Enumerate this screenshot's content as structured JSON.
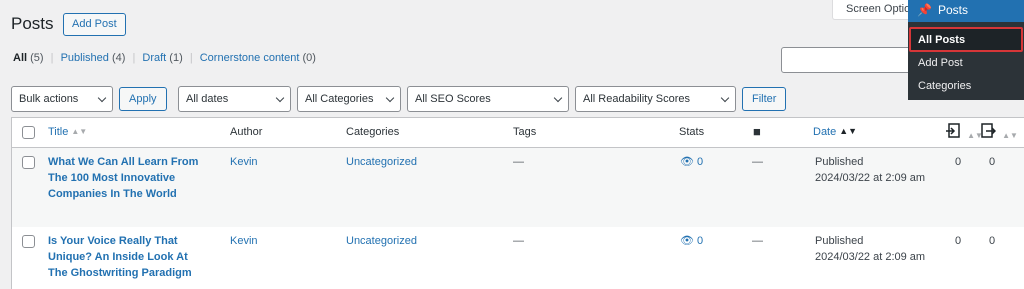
{
  "page": {
    "title": "Posts",
    "add_post_label": "Add Post",
    "screen_options_label": "Screen Options"
  },
  "views": {
    "all_label": "All",
    "all_count": "(5)",
    "published_label": "Published",
    "published_count": "(4)",
    "draft_label": "Draft",
    "draft_count": "(1)",
    "cornerstone_label": "Cornerstone content",
    "cornerstone_count": "(0)"
  },
  "filters": {
    "bulk_actions": "Bulk actions",
    "apply_label": "Apply",
    "dates": "All dates",
    "categories": "All Categories",
    "seo_scores": "All SEO Scores",
    "readability_scores": "All Readability Scores",
    "filter_label": "Filter"
  },
  "columns": {
    "title": "Title",
    "author": "Author",
    "categories": "Categories",
    "tags": "Tags",
    "stats": "Stats",
    "date": "Date"
  },
  "rows": [
    {
      "title_line1": "What We Can All Learn From",
      "title_line2": "The 100 Most Innovative",
      "title_line3": "Companies In The World",
      "author": "Kevin",
      "category": "Uncategorized",
      "tags": "—",
      "stats": "0",
      "comments": "—",
      "date_status": "Published",
      "date_value": "2024/03/22 at 2:09 am",
      "links_in": "0",
      "links_out": "0"
    },
    {
      "title_line1": "Is Your Voice Really That",
      "title_line2": "Unique? An Inside Look At",
      "title_line3": "The Ghostwriting Paradigm",
      "author": "Kevin",
      "category": "Uncategorized",
      "tags": "—",
      "stats": "0",
      "comments": "—",
      "date_status": "Published",
      "date_value": "2024/03/22 at 2:09 am",
      "links_in": "0",
      "links_out": "0"
    }
  ],
  "admin_menu": {
    "heading": "Posts",
    "items": [
      "All Posts",
      "Add Post",
      "Categories"
    ]
  },
  "colors": {
    "accent": "#2271b1",
    "highlight_border": "#d63638",
    "menu_bg": "#2c3338"
  }
}
